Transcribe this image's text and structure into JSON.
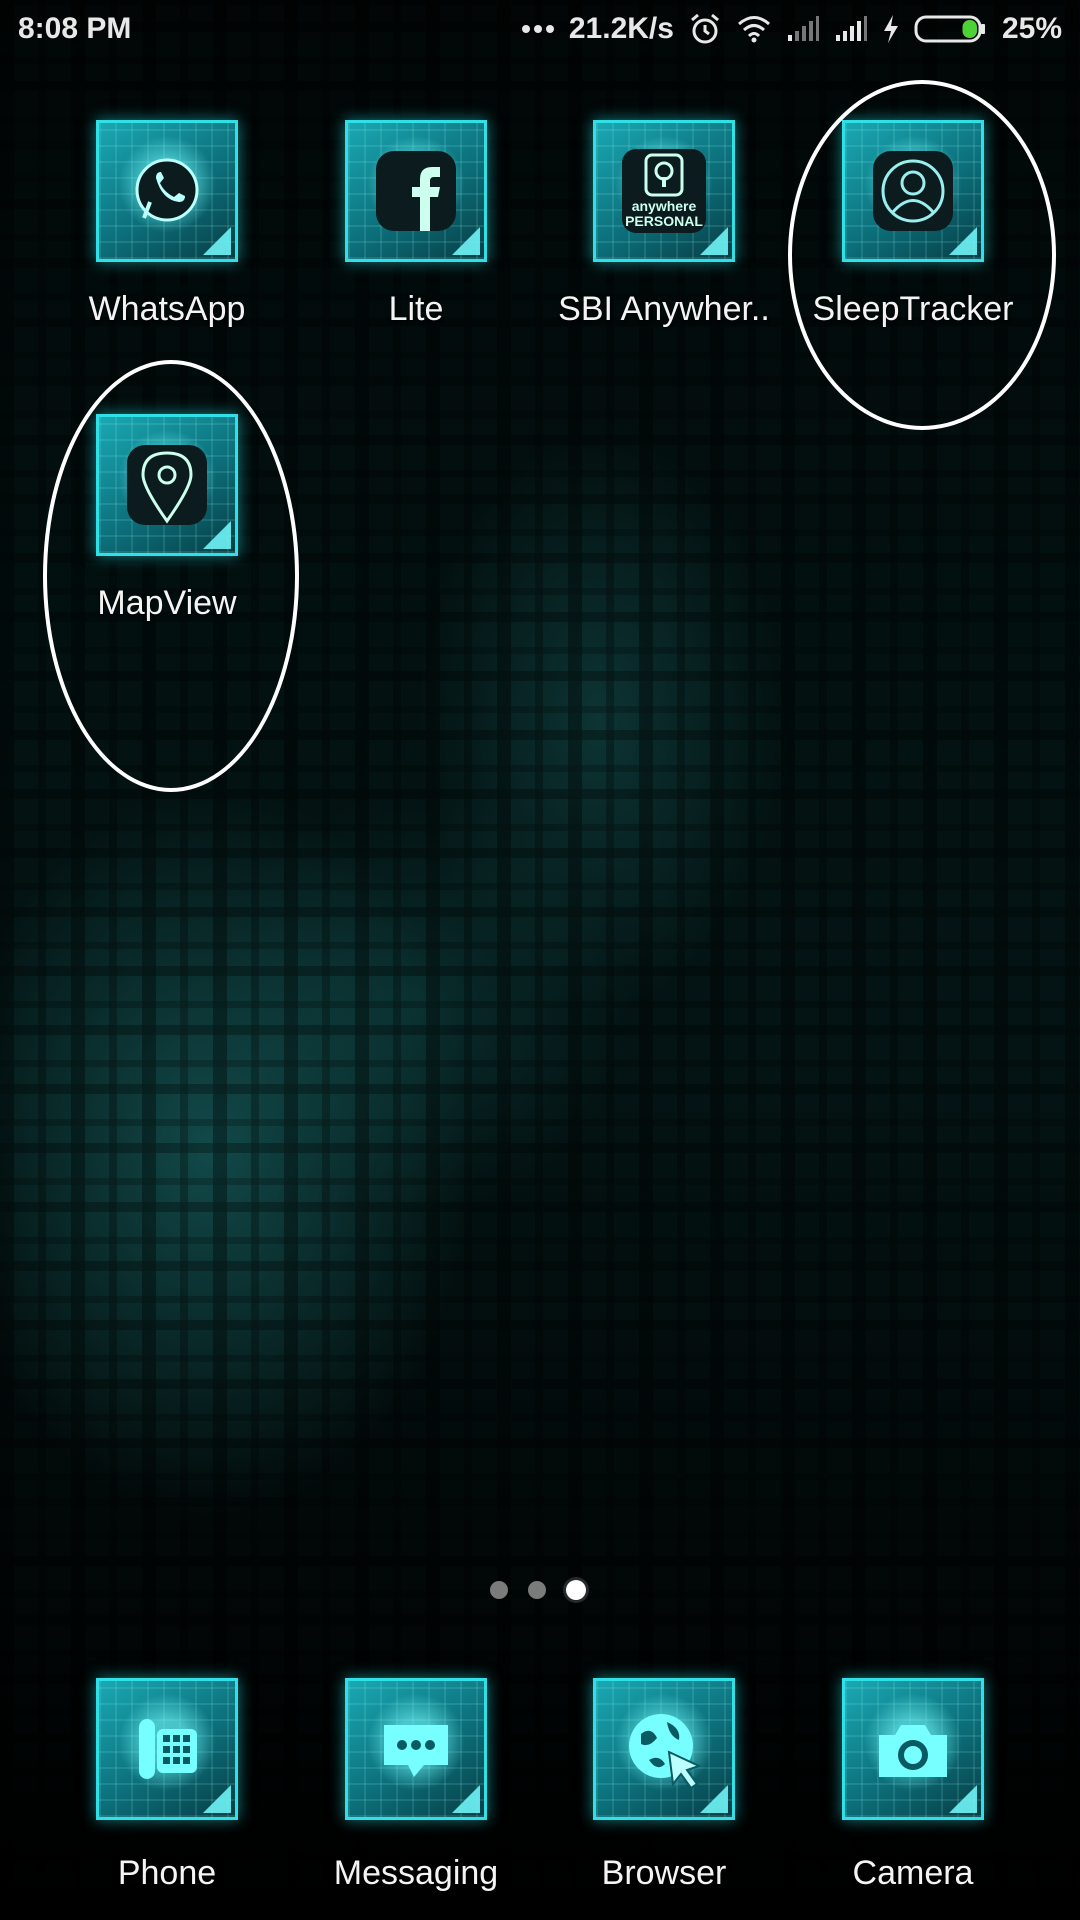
{
  "status_bar": {
    "time": "8:08 PM",
    "net_speed": "21.2K/s",
    "battery_percent": "25%",
    "battery_level": 0.25,
    "icons": [
      "more-dots-icon",
      "alarm-icon",
      "wifi-icon",
      "signal-1-icon",
      "signal-2-icon",
      "charging-icon",
      "battery-icon"
    ]
  },
  "home_apps": [
    {
      "label": "WhatsApp",
      "icon": "whatsapp-icon"
    },
    {
      "label": "Lite",
      "icon": "facebook-icon"
    },
    {
      "label": "SBI Anywher..",
      "icon": "sbi-anywhere-icon",
      "icon_text": "anywhere PERSONAL"
    },
    {
      "label": "SleepTracker",
      "icon": "user-profile-icon"
    },
    {
      "label": "MapView",
      "icon": "map-pin-icon"
    }
  ],
  "page_indicator": {
    "pages": 3,
    "current": 3
  },
  "dock_apps": [
    {
      "label": "Phone",
      "icon": "phone-icon"
    },
    {
      "label": "Messaging",
      "icon": "message-icon"
    },
    {
      "label": "Browser",
      "icon": "browser-icon"
    },
    {
      "label": "Camera",
      "icon": "camera-icon"
    }
  ],
  "annotations": {
    "highlight_color": "#ffffff",
    "highlighted_apps": [
      "SleepTracker",
      "MapView"
    ]
  },
  "theme": {
    "accent": "#2fe0e6",
    "label_color": "#f4f4f4"
  }
}
